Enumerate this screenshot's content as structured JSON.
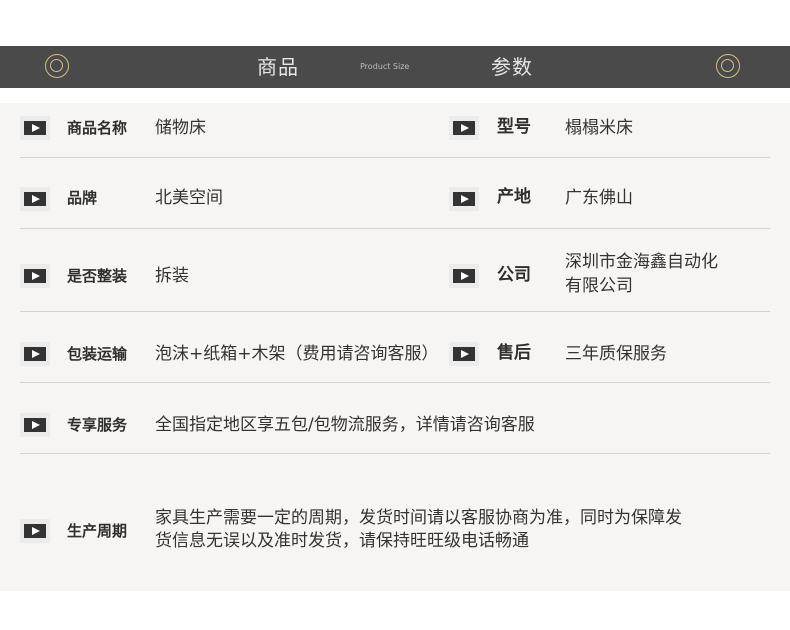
{
  "header": {
    "title_left": "商品",
    "subtitle": "Product Size",
    "title_right": "参数"
  },
  "specs": {
    "product_name": {
      "label": "商品名称",
      "value": "储物床"
    },
    "model": {
      "label": "型号",
      "value": "榻榻米床"
    },
    "brand": {
      "label": "品牌",
      "value": "北美空间"
    },
    "origin": {
      "label": "产地",
      "value": "广东佛山"
    },
    "assembled": {
      "label": "是否整装",
      "value": "拆装"
    },
    "company": {
      "label": "公司",
      "value_line1": "深圳市金海鑫自动化",
      "value_line2": "有限公司"
    },
    "packaging": {
      "label": "包装运输",
      "value": "泡沫+纸箱+木架（费用请咨询客服）"
    },
    "after_sales": {
      "label": "售后",
      "value": "三年质保服务"
    },
    "exclusive_service": {
      "label": "专享服务",
      "value": "全国指定地区享五包/包物流服务，详情请咨询客服"
    },
    "production_cycle": {
      "label": "生产周期",
      "value_line1": "家具生产需要一定的周期，发货时间请以客服协商为准，同时为保障发",
      "value_line2": "货信息无误以及准时发货，请保持旺旺级电话畅通"
    }
  }
}
